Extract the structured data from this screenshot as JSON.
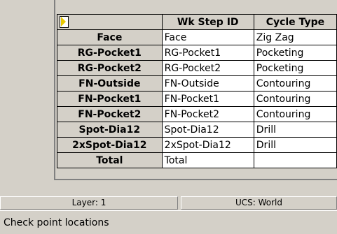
{
  "grid": {
    "columns": [
      "Wk Step ID",
      "Cycle Type"
    ],
    "rows": [
      {
        "name": "Face",
        "wk_step_id": "Face",
        "cycle_type": "Zig Zag"
      },
      {
        "name": "RG-Pocket1",
        "wk_step_id": "RG-Pocket1",
        "cycle_type": "Pocketing"
      },
      {
        "name": "RG-Pocket2",
        "wk_step_id": "RG-Pocket2",
        "cycle_type": "Pocketing"
      },
      {
        "name": "FN-Outside",
        "wk_step_id": "FN-Outside",
        "cycle_type": "Contouring"
      },
      {
        "name": "FN-Pocket1",
        "wk_step_id": "FN-Pocket1",
        "cycle_type": "Contouring"
      },
      {
        "name": "FN-Pocket2",
        "wk_step_id": "FN-Pocket2",
        "cycle_type": "Contouring"
      },
      {
        "name": "Spot-Dia12",
        "wk_step_id": "Spot-Dia12",
        "cycle_type": "Drill"
      },
      {
        "name": "2xSpot-Dia12",
        "wk_step_id": "2xSpot-Dia12",
        "cycle_type": "Drill"
      },
      {
        "name": "Total",
        "wk_step_id": "Total",
        "cycle_type": ""
      }
    ]
  },
  "status": {
    "layer": "Layer: 1",
    "ucs": "UCS: World"
  },
  "hint": "Check point locations",
  "colors": {
    "face": "#d4d0c8",
    "cell_bg": "#ffffff",
    "corner_icon": "#e8c800"
  },
  "icons": {
    "corner": "select-all-corner-icon"
  }
}
